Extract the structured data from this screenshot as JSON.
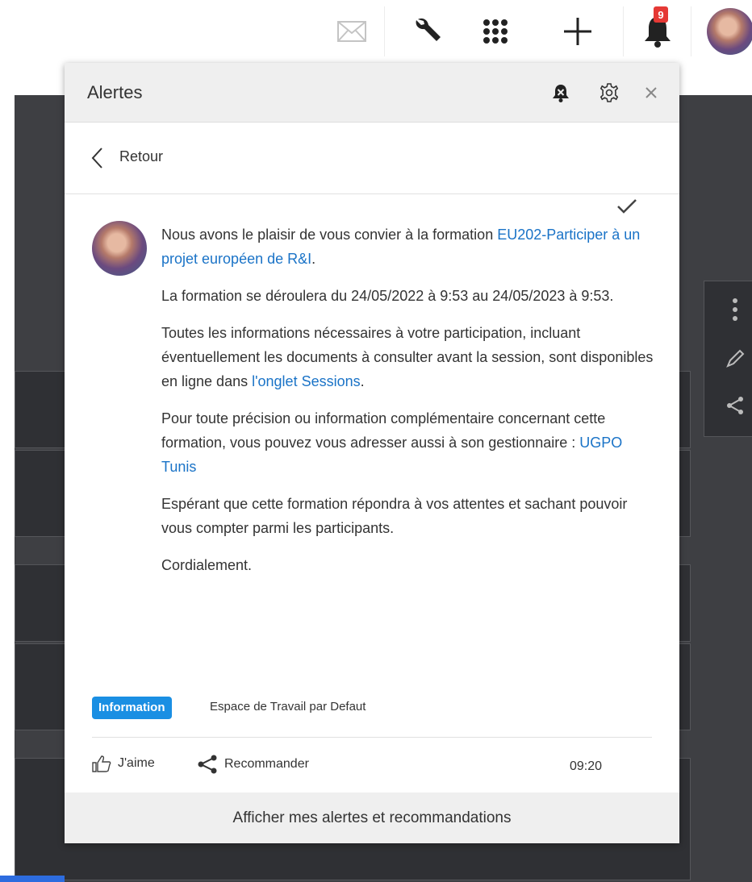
{
  "topbar": {
    "notification_count": "9",
    "icons": [
      "mail-icon",
      "wrench-icon",
      "apps-grid-icon",
      "plus-icon",
      "bell-icon",
      "avatar"
    ]
  },
  "panel": {
    "title": "Alertes",
    "back_label": "Retour",
    "message": {
      "p1_text": "Nous avons le plaisir de vous convier à la formation ",
      "p1_link": "EU202-Participer à un projet européen de R&I",
      "p1_end": ".",
      "p2": "La formation se déroulera du 24/05/2022 à 9:53 au 24/05/2023 à 9:53.",
      "p3_text": "Toutes les informations nécessaires à votre participation, incluant éventuellement les documents à consulter avant la session, sont disponibles en ligne dans ",
      "p3_link": "l'onglet Sessions",
      "p3_end": ".",
      "p4_text": "Pour toute précision ou information complémentaire concernant cette formation, vous pouvez vous adresser aussi à son gestionnaire : ",
      "p4_link": "UGPO Tunis",
      "p5": "Espérant que cette formation répondra à vos attentes et sachant pouvoir vous compter parmi les participants.",
      "p6": "Cordialement."
    },
    "tag": "Information",
    "workspace": "Espace de Travail par Defaut",
    "like_label": "J'aime",
    "recommend_label": "Recommander",
    "time": "09:20",
    "footer_label": "Afficher mes alertes et recommandations"
  },
  "colors": {
    "link": "#1a73c7",
    "tag": "#1a8fe3",
    "badge": "#e53935",
    "header_bg": "#efefef",
    "backdrop": "#3e3f43"
  }
}
